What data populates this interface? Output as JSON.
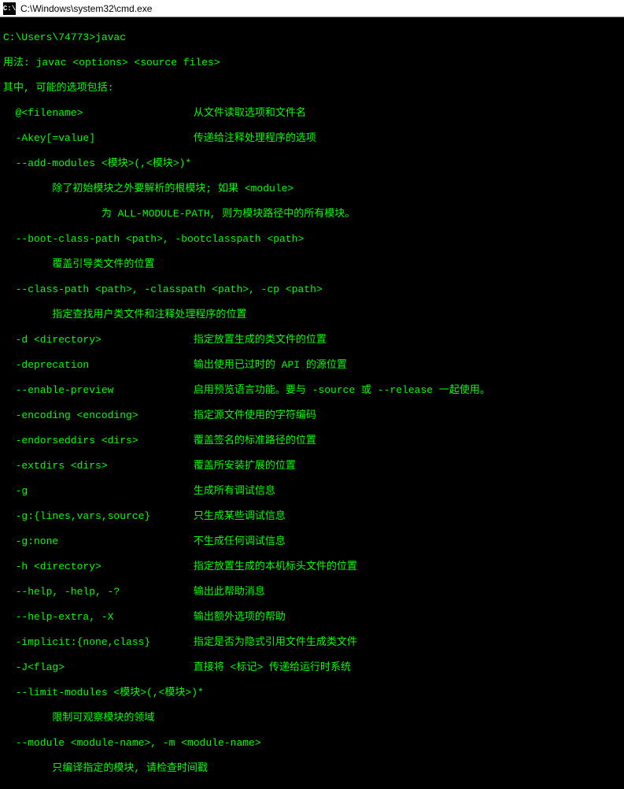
{
  "window": {
    "icon_label": "C:\\",
    "title": "C:\\Windows\\system32\\cmd.exe"
  },
  "terminal": {
    "prompt": "C:\\Users\\74773>",
    "command": "javac",
    "lines": [
      "用法: javac <options> <source files>",
      "其中, 可能的选项包括:",
      "  @<filename>                  从文件读取选项和文件名",
      "  -Akey[=value]                传递给注释处理程序的选项",
      "  --add-modules <模块>(,<模块>)*",
      "        除了初始模块之外要解析的根模块; 如果 <module>",
      "                为 ALL-MODULE-PATH, 则为模块路径中的所有模块。",
      "  --boot-class-path <path>, -bootclasspath <path>",
      "        覆盖引导类文件的位置",
      "  --class-path <path>, -classpath <path>, -cp <path>",
      "        指定查找用户类文件和注释处理程序的位置",
      "  -d <directory>               指定放置生成的类文件的位置",
      "  -deprecation                 输出使用已过时的 API 的源位置",
      "  --enable-preview             启用预览语言功能。要与 -source 或 --release 一起使用。",
      "  -encoding <encoding>         指定源文件使用的字符编码",
      "  -endorseddirs <dirs>         覆盖签名的标准路径的位置",
      "  -extdirs <dirs>              覆盖所安装扩展的位置",
      "  -g                           生成所有调试信息",
      "  -g:{lines,vars,source}       只生成某些调试信息",
      "  -g:none                      不生成任何调试信息",
      "  -h <directory>               指定放置生成的本机标头文件的位置",
      "  --help, -help, -?            输出此帮助消息",
      "  --help-extra, -X             输出额外选项的帮助",
      "  -implicit:{none,class}       指定是否为隐式引用文件生成类文件",
      "  -J<flag>                     直接将 <标记> 传递给运行时系统",
      "  --limit-modules <模块>(,<模块>)*",
      "        限制可观察模块的领域",
      "  --module <module-name>, -m <module-name>",
      "        只编译指定的模块, 请检查时间戳"
    ]
  }
}
